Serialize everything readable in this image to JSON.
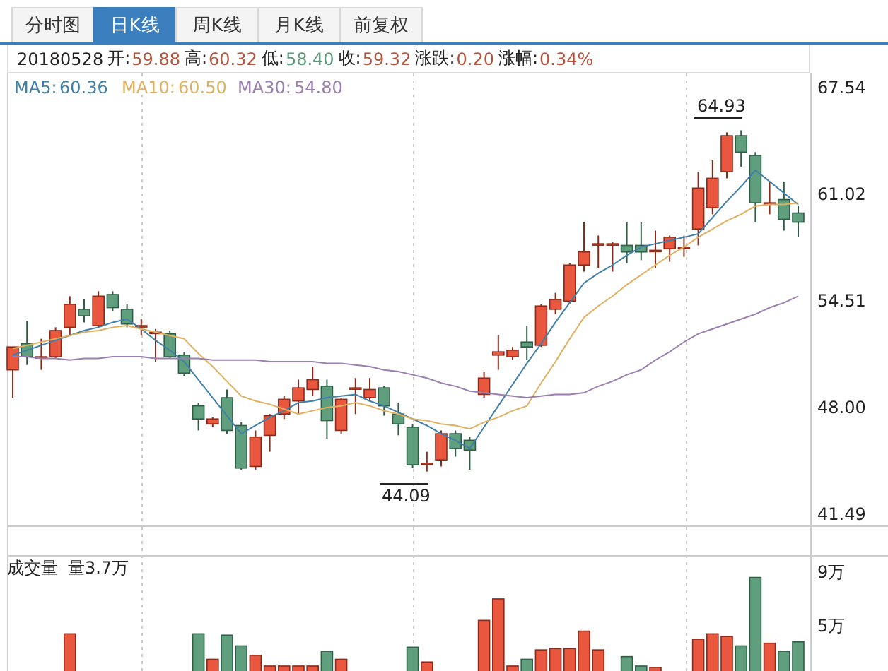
{
  "tabs": [
    {
      "label": "分时图",
      "selected": false
    },
    {
      "label": "日K线",
      "selected": true
    },
    {
      "label": "周K线",
      "selected": false
    },
    {
      "label": "月K线",
      "selected": false
    },
    {
      "label": "前复权",
      "selected": false
    }
  ],
  "quote": {
    "date": "20180528",
    "fields": [
      {
        "label": "开:",
        "value": "59.88",
        "color": "#b5533c"
      },
      {
        "label": "高:",
        "value": "60.32",
        "color": "#b5533c"
      },
      {
        "label": "低:",
        "value": "58.40",
        "color": "#5a9a78"
      },
      {
        "label": "收:",
        "value": "59.32",
        "color": "#b5533c"
      },
      {
        "label": "涨跌:",
        "value": "0.20",
        "color": "#b5533c"
      },
      {
        "label": "涨幅:",
        "value": "0.34%",
        "color": "#b5533c"
      }
    ]
  },
  "price_chart": {
    "high_marker": "64.93",
    "low_marker": "44.09",
    "legend_values": [
      "60.36",
      "60.50",
      "54.80"
    ],
    "chart_data": {
      "type": "candlestick",
      "grid": true,
      "ylim": [
        40.71,
        68.4
      ],
      "categories": [
        null,
        null,
        null,
        null,
        null,
        null,
        null,
        null,
        null,
        null,
        null,
        null,
        null,
        null,
        null,
        null,
        null,
        null,
        null,
        null,
        null,
        null,
        null,
        null,
        null,
        null,
        null,
        null,
        null,
        null,
        null,
        null,
        null,
        null,
        null,
        null,
        null,
        null,
        null,
        null,
        null,
        null,
        null,
        null,
        null,
        null,
        null,
        null,
        null,
        null,
        null,
        null,
        null,
        null,
        null,
        null
      ],
      "yticks": [
        {
          "value": 67.54,
          "label": "67.54"
        },
        {
          "value": 61.02,
          "label": "61.02"
        },
        {
          "value": 54.51,
          "label": "54.51"
        },
        {
          "value": 48.0,
          "label": "48.00"
        },
        {
          "value": 41.49,
          "label": "41.49"
        }
      ],
      "ohlc": [
        [
          50.3,
          51.7,
          48.6,
          51.7
        ],
        [
          51.9,
          53.3,
          50.6,
          51.1
        ],
        [
          51.1,
          52.2,
          50.3,
          51.1
        ],
        [
          51.1,
          52.9,
          51.0,
          52.7
        ],
        [
          52.9,
          54.8,
          52.4,
          54.3
        ],
        [
          54.0,
          54.6,
          53.2,
          53.6
        ],
        [
          53.0,
          55.1,
          52.9,
          54.8
        ],
        [
          54.9,
          55.1,
          53.9,
          54.1
        ],
        [
          54.0,
          54.3,
          52.9,
          53.1
        ],
        [
          53.0,
          53.4,
          52.4,
          53.0
        ],
        [
          52.6,
          52.8,
          50.8,
          52.6
        ],
        [
          52.5,
          52.7,
          51.0,
          51.1
        ],
        [
          51.2,
          51.4,
          49.9,
          50.1
        ],
        [
          48.1,
          48.3,
          46.6,
          47.3
        ],
        [
          47.0,
          47.4,
          46.8,
          47.3
        ],
        [
          48.6,
          49.1,
          46.4,
          46.6
        ],
        [
          46.9,
          47.1,
          44.2,
          44.3
        ],
        [
          44.4,
          46.6,
          44.2,
          46.2
        ],
        [
          46.3,
          47.6,
          45.3,
          47.5
        ],
        [
          47.6,
          48.7,
          47.3,
          48.5
        ],
        [
          48.4,
          49.7,
          47.6,
          49.2
        ],
        [
          49.1,
          50.5,
          48.7,
          49.7
        ],
        [
          49.3,
          49.7,
          46.1,
          47.2
        ],
        [
          46.6,
          48.6,
          46.4,
          48.5
        ],
        [
          49.2,
          49.8,
          47.6,
          49.2
        ],
        [
          48.6,
          49.8,
          48.4,
          49.1
        ],
        [
          49.2,
          49.3,
          47.5,
          48.1
        ],
        [
          47.6,
          48.3,
          46.3,
          47.0
        ],
        [
          46.8,
          47.0,
          44.3,
          44.5
        ],
        [
          44.6,
          45.3,
          44.09,
          44.6
        ],
        [
          44.8,
          46.6,
          44.4,
          46.4
        ],
        [
          46.4,
          46.6,
          45.0,
          45.5
        ],
        [
          46.0,
          46.2,
          44.2,
          45.4
        ],
        [
          48.8,
          50.2,
          48.6,
          49.8
        ],
        [
          51.2,
          52.4,
          50.3,
          51.4
        ],
        [
          51.1,
          51.7,
          50.9,
          51.5
        ],
        [
          52.0,
          53.0,
          50.9,
          51.7
        ],
        [
          51.8,
          54.3,
          51.7,
          54.2
        ],
        [
          54.0,
          55.0,
          53.7,
          54.6
        ],
        [
          54.5,
          56.8,
          54.3,
          56.7
        ],
        [
          56.7,
          59.3,
          56.3,
          57.5
        ],
        [
          58.0,
          58.5,
          56.5,
          58.0
        ],
        [
          58.0,
          58.1,
          56.3,
          58.0
        ],
        [
          57.9,
          59.3,
          56.8,
          57.5
        ],
        [
          57.9,
          59.3,
          57.0,
          57.5
        ],
        [
          57.6,
          58.8,
          56.5,
          57.6
        ],
        [
          57.7,
          58.5,
          56.9,
          58.4
        ],
        [
          57.8,
          58.5,
          57.2,
          57.8
        ],
        [
          58.9,
          62.4,
          57.9,
          61.4
        ],
        [
          60.2,
          63.1,
          59.8,
          62.0
        ],
        [
          62.4,
          64.8,
          62.0,
          64.6
        ],
        [
          64.6,
          64.93,
          62.7,
          63.6
        ],
        [
          63.4,
          63.6,
          59.3,
          60.5
        ],
        [
          60.5,
          61.8,
          59.8,
          60.5
        ],
        [
          60.7,
          61.8,
          58.8,
          59.5
        ],
        [
          59.88,
          60.32,
          58.4,
          59.32
        ]
      ]
    }
  },
  "moving_averages": {
    "chart_data": {
      "type": "line",
      "ylim": [
        40.71,
        68.4
      ],
      "categories": [
        null,
        null,
        null,
        null,
        null,
        null,
        null,
        null,
        null,
        null,
        null,
        null,
        null,
        null,
        null,
        null,
        null,
        null,
        null,
        null,
        null,
        null,
        null,
        null,
        null,
        null,
        null,
        null,
        null,
        null,
        null,
        null,
        null,
        null,
        null,
        null,
        null,
        null,
        null,
        null,
        null,
        null,
        null,
        null,
        null,
        null,
        null,
        null,
        null,
        null,
        null,
        null,
        null,
        null,
        null,
        null
      ],
      "series": [
        {
          "name": "MA5:",
          "color": "#3f7fa8",
          "values": [
            51.2,
            51.5,
            51.8,
            52.1,
            52.4,
            52.7,
            52.9,
            53.2,
            53.4,
            52.8,
            52.1,
            51.5,
            50.8,
            49.7,
            48.6,
            47.5,
            46.4,
            46.9,
            47.4,
            47.8,
            48.3,
            48.4,
            48.6,
            48.7,
            48.8,
            48.4,
            48.1,
            47.7,
            47.3,
            46.9,
            46.4,
            46.0,
            45.5,
            46.8,
            48.1,
            49.4,
            50.7,
            51.9,
            53.2,
            54.4,
            55.6,
            56.2,
            56.7,
            57.3,
            57.8,
            58.0,
            58.2,
            58.4,
            58.6,
            59.6,
            60.6,
            61.5,
            62.5,
            61.8,
            61.1,
            60.4
          ]
        },
        {
          "name": "MA10:",
          "color": "#e0b060",
          "values": [
            51.6,
            51.8,
            52.0,
            52.2,
            52.4,
            52.6,
            52.7,
            52.9,
            53.0,
            52.8,
            52.6,
            52.4,
            52.2,
            51.3,
            50.5,
            49.6,
            48.7,
            48.4,
            48.2,
            47.9,
            47.6,
            47.8,
            48.0,
            48.1,
            48.3,
            48.1,
            47.8,
            47.6,
            47.3,
            47.2,
            47.0,
            46.9,
            46.7,
            47.1,
            47.4,
            47.8,
            48.1,
            49.5,
            50.8,
            52.2,
            53.5,
            54.2,
            54.8,
            55.5,
            56.1,
            56.7,
            57.3,
            57.8,
            58.4,
            58.9,
            59.4,
            59.8,
            60.3,
            60.4,
            60.4,
            60.5
          ]
        },
        {
          "name": "MA30:",
          "color": "#9b7fb0",
          "values": [
            51.1,
            51.1,
            51.0,
            51.0,
            50.9,
            51.0,
            51.0,
            51.1,
            51.1,
            51.1,
            51.0,
            51.0,
            51.0,
            51.0,
            50.9,
            50.9,
            50.9,
            50.9,
            50.8,
            50.8,
            50.8,
            50.8,
            50.7,
            50.7,
            50.6,
            50.5,
            50.3,
            50.2,
            50.0,
            49.8,
            49.5,
            49.3,
            49.0,
            48.9,
            48.8,
            48.7,
            48.6,
            48.7,
            48.8,
            48.8,
            48.9,
            49.3,
            49.6,
            50.0,
            50.3,
            50.9,
            51.4,
            52.0,
            52.5,
            52.8,
            53.1,
            53.4,
            53.7,
            54.1,
            54.4,
            54.8
          ]
        }
      ]
    }
  },
  "volume": {
    "title": "成交量",
    "reading": "量3.7万",
    "chart_data": {
      "type": "bar",
      "grid": true,
      "ylim": [
        1.53,
        10.16
      ],
      "categories": [
        null,
        null,
        null,
        null,
        null,
        null,
        null,
        null,
        null,
        null,
        null,
        null,
        null,
        null,
        null,
        null,
        null,
        null,
        null,
        null,
        null,
        null,
        null,
        null,
        null,
        null,
        null,
        null,
        null,
        null,
        null,
        null,
        null,
        null,
        null,
        null,
        null,
        null,
        null,
        null,
        null,
        null,
        null,
        null,
        null,
        null,
        null,
        null,
        null,
        null,
        null,
        null,
        null,
        null,
        null,
        null
      ],
      "yticks": [
        {
          "value": 9,
          "label": "9万"
        },
        {
          "value": 5,
          "label": "5万"
        }
      ],
      "values": [
        null,
        null,
        null,
        null,
        4.3,
        null,
        null,
        null,
        null,
        null,
        null,
        null,
        null,
        4.3,
        2.4,
        4.2,
        3.4,
        2.7,
        1.9,
        1.9,
        1.9,
        1.9,
        3.0,
        2.4,
        null,
        null,
        null,
        null,
        3.3,
        2.2,
        null,
        null,
        null,
        5.3,
        6.9,
        1.9,
        2.4,
        3.1,
        3.2,
        3.2,
        4.5,
        3.1,
        null,
        2.6,
        1.9,
        1.8,
        null,
        null,
        3.9,
        4.3,
        4.1,
        3.4,
        8.5,
        3.6,
        3.0,
        3.7
      ]
    }
  }
}
